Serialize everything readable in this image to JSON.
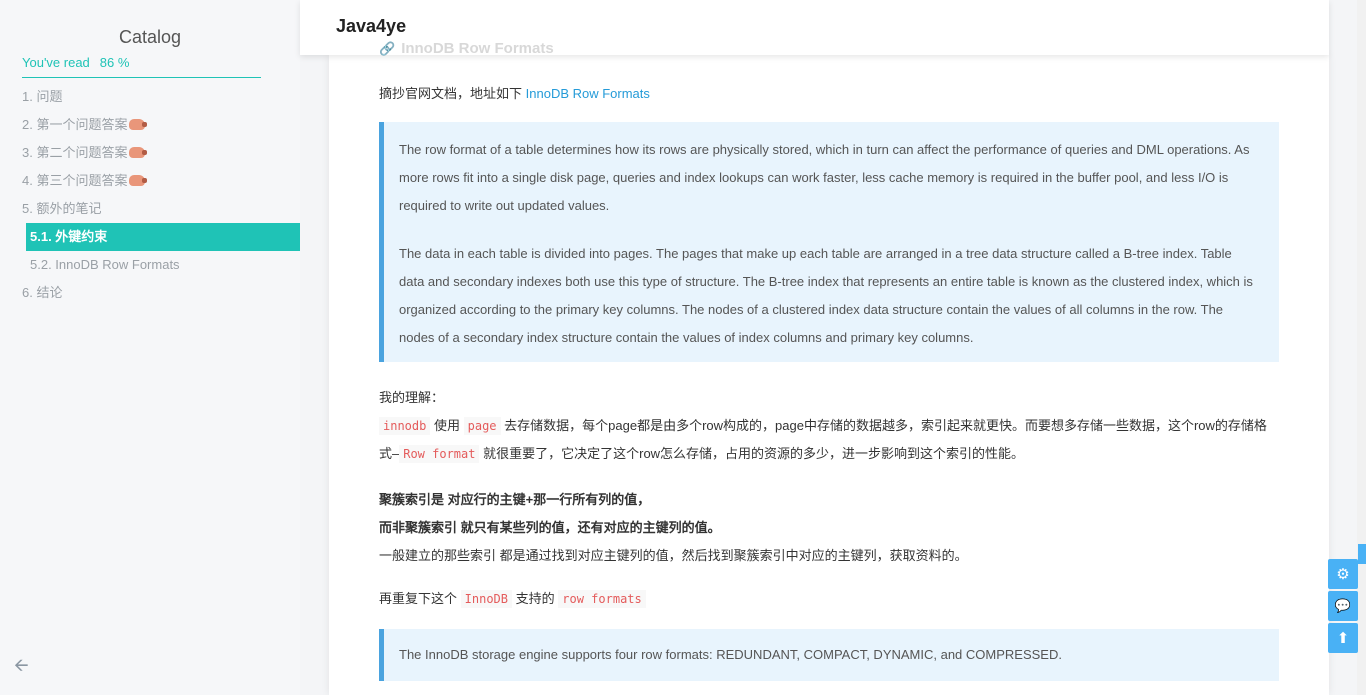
{
  "sidebar": {
    "catalog_title": "Catalog",
    "progress_label": "You've read",
    "progress_value": "86 %",
    "items": [
      {
        "label": "1. 问题",
        "pig": false
      },
      {
        "label": "2. 第一个问题答案",
        "pig": true
      },
      {
        "label": "3. 第二个问题答案",
        "pig": true
      },
      {
        "label": "4. 第三个问题答案",
        "pig": true
      },
      {
        "label": "5. 额外的笔记",
        "pig": false
      },
      {
        "label": "5.1. 外键约束",
        "pig": false
      },
      {
        "label": "5.2. InnoDB Row Formats",
        "pig": false
      },
      {
        "label": "6. 结论",
        "pig": false
      }
    ],
    "back_icon": "arrow-left-icon"
  },
  "header": {
    "site_title": "Java4ye",
    "faded_heading": "InnoDB Row Formats"
  },
  "article": {
    "intro_text": "摘抄官网文档，地址如下",
    "intro_link": "InnoDB Row Formats",
    "quote1_p1": "The row format of a table determines how its rows are physically stored, which in turn can affect the performance of queries and DML operations. As more rows fit into a single disk page, queries and index lookups can work faster, less cache memory is required in the buffer pool, and less I/O is required to write out updated values.",
    "quote1_p2": "The data in each table is divided into pages. The pages that make up each table are arranged in a tree data structure called a B-tree index. Table data and secondary indexes both use this type of structure. The B-tree index that represents an entire table is known as the clustered index, which is organized according to the primary key columns. The nodes of a clustered index data structure contain the values of all columns in the row. The nodes of a secondary index structure contain the values of index columns and primary key columns.",
    "understanding_label": "我的理解：",
    "u_code1": "innodb",
    "u_t1": "使用",
    "u_code2": "page",
    "u_t2": "去存储数据，每个page都是由多个row构成的，page中存储的数据越多，索引起来就更快。而要想多存储一些数据，这个row的存储格式–",
    "u_code3": "Row format",
    "u_t3": "就很重要了，它决定了这个row怎么存储，占用的资源的多少，进一步影响到这个索引的性能。",
    "bold_line1": "聚簇索引是 对应行的主键+那一行所有列的值，",
    "bold_line2": "而非聚簇索引 就只有某些列的值，还有对应的主键列的值。",
    "normal_line": "一般建立的那些索引 都是通过找到对应主键列的值，然后找到聚簇索引中对应的主键列，获取资料的。",
    "repeat_t1": "再重复下这个",
    "repeat_code1": "InnoDB",
    "repeat_t2": "支持的",
    "repeat_code2": "row formats",
    "quote2": "The InnoDB storage engine supports four row formats: REDUNDANT, COMPACT, DYNAMIC, and COMPRESSED."
  },
  "float_buttons": [
    {
      "icon": "gear-icon",
      "glyph": "⚙"
    },
    {
      "icon": "comments-icon",
      "glyph": "💬"
    },
    {
      "icon": "arrow-up-icon",
      "glyph": "⬆"
    }
  ],
  "colors": {
    "accent": "#1fc3b6",
    "link": "#259bd8",
    "quote_bg": "#e8f4fd",
    "quote_border": "#4aa3df",
    "code": "#e45b5b",
    "button": "#49b1f5"
  }
}
